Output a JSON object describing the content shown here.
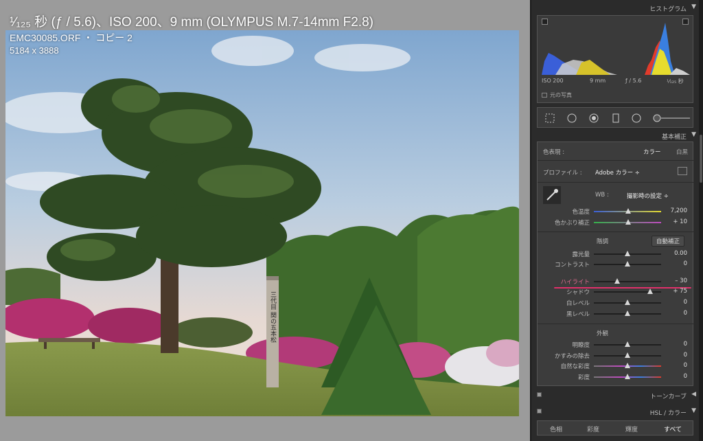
{
  "viewer": {
    "exif_line": "¹⁄₁₂₅ 秒 (ƒ / 5.6)、ISO 200、9 mm (OLYMPUS M.7-14mm F2.8)",
    "file_line": "EMC30085.ORF ・ コピー 2",
    "dims_line": "5184 x 3888",
    "post_text": "三代目 関の五本松"
  },
  "histogram": {
    "title": "ヒストグラム",
    "iso": "ISO 200",
    "focal": "9 mm",
    "aperture": "ƒ / 5.6",
    "shutter": "¹⁄₁₂₅ 秒",
    "original_photo": "元の写真"
  },
  "basic": {
    "header": "基本補正",
    "treatment_label": "色表現 :",
    "treatment_color": "カラー",
    "treatment_bw": "白黒",
    "profile_label": "プロファイル :",
    "profile_value": "Adobe カラー ÷",
    "wb_label": "WB :",
    "wb_value": "撮影時の設定 ÷",
    "temp_label": "色温度",
    "temp_value": "7,200",
    "tint_label": "色かぶり補正",
    "tint_value": "+ 10",
    "tone_label": "階調",
    "auto_label": "自動補正",
    "exposure_label": "露光量",
    "exposure_value": "0.00",
    "contrast_label": "コントラスト",
    "contrast_value": "0",
    "highlights_label": "ハイライト",
    "highlights_value": "– 30",
    "shadows_label": "シャドウ",
    "shadows_value": "+ 75",
    "whites_label": "白レベル",
    "whites_value": "0",
    "blacks_label": "黒レベル",
    "blacks_value": "0",
    "presence_label": "外観",
    "clarity_label": "明瞭度",
    "clarity_value": "0",
    "dehaze_label": "かすみの除去",
    "dehaze_value": "0",
    "vibrance_label": "自然な彩度",
    "vibrance_value": "0",
    "saturation_label": "彩度",
    "saturation_value": "0"
  },
  "tone_curve": {
    "header": "トーンカーブ"
  },
  "hsl": {
    "header": "HSL / カラー",
    "tab_hue": "色相",
    "tab_saturation": "彩度",
    "tab_luminance": "輝度",
    "tab_all": "すべて"
  },
  "colors": {
    "highlight_underline": "#e0306a",
    "panel_bg": "#2b2b2b"
  }
}
